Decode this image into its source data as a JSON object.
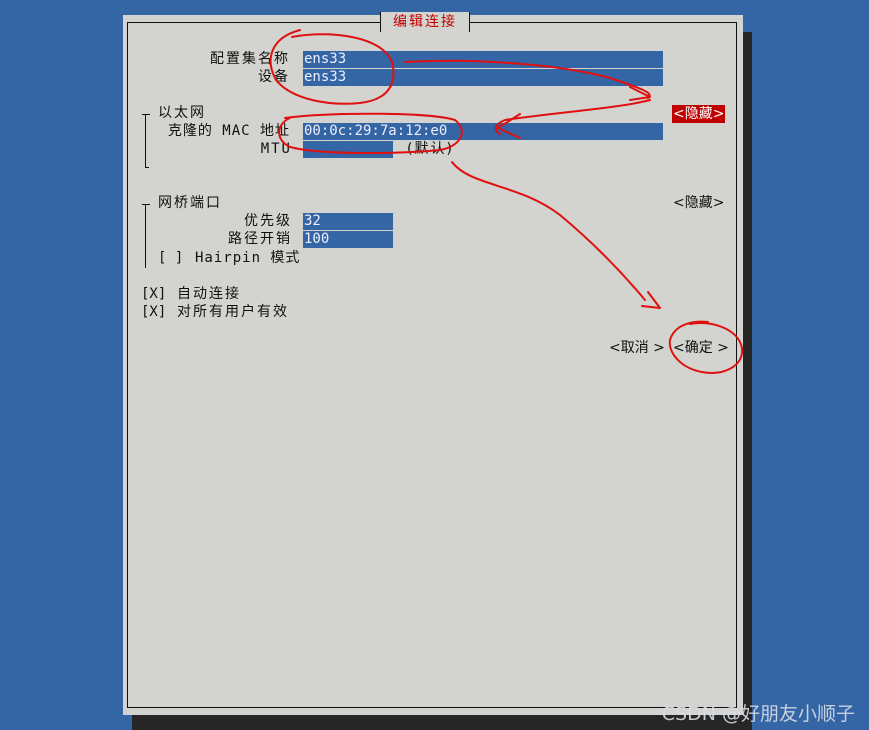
{
  "dialog": {
    "title": "编辑连接"
  },
  "profile": {
    "name_label": "配置集名称",
    "name_value": "ens33",
    "device_label": "设备",
    "device_value": "ens33"
  },
  "ethernet": {
    "section_label": "以太网",
    "toggle_label": "<隐藏>",
    "mac_label": "克隆的 MAC 地址",
    "mac_value": "00:0c:29:7a:12:e0",
    "mtu_label": "MTU",
    "mtu_value": "",
    "mtu_hint": "(默认)"
  },
  "bridge_port": {
    "section_label": "网桥端口",
    "toggle_label": "<隐藏>",
    "priority_label": "优先级",
    "priority_value": "32",
    "path_cost_label": "路径开销",
    "path_cost_value": "100",
    "hairpin_checkbox": "[ ]",
    "hairpin_label": "Hairpin 模式"
  },
  "options": {
    "autoconnect_checkbox": "[X]",
    "autoconnect_label": "自动连接",
    "all_users_checkbox": "[X]",
    "all_users_label": "对所有用户有效"
  },
  "buttons": {
    "cancel": "<取消 >",
    "ok": "<确定 >"
  },
  "watermark": "CSDN @好朋友小顺子",
  "colors": {
    "background": "#3465a4",
    "dialog": "#d3d4cf",
    "field": "#3465a4",
    "focus": "#c00000",
    "annotation": "#e01010"
  }
}
